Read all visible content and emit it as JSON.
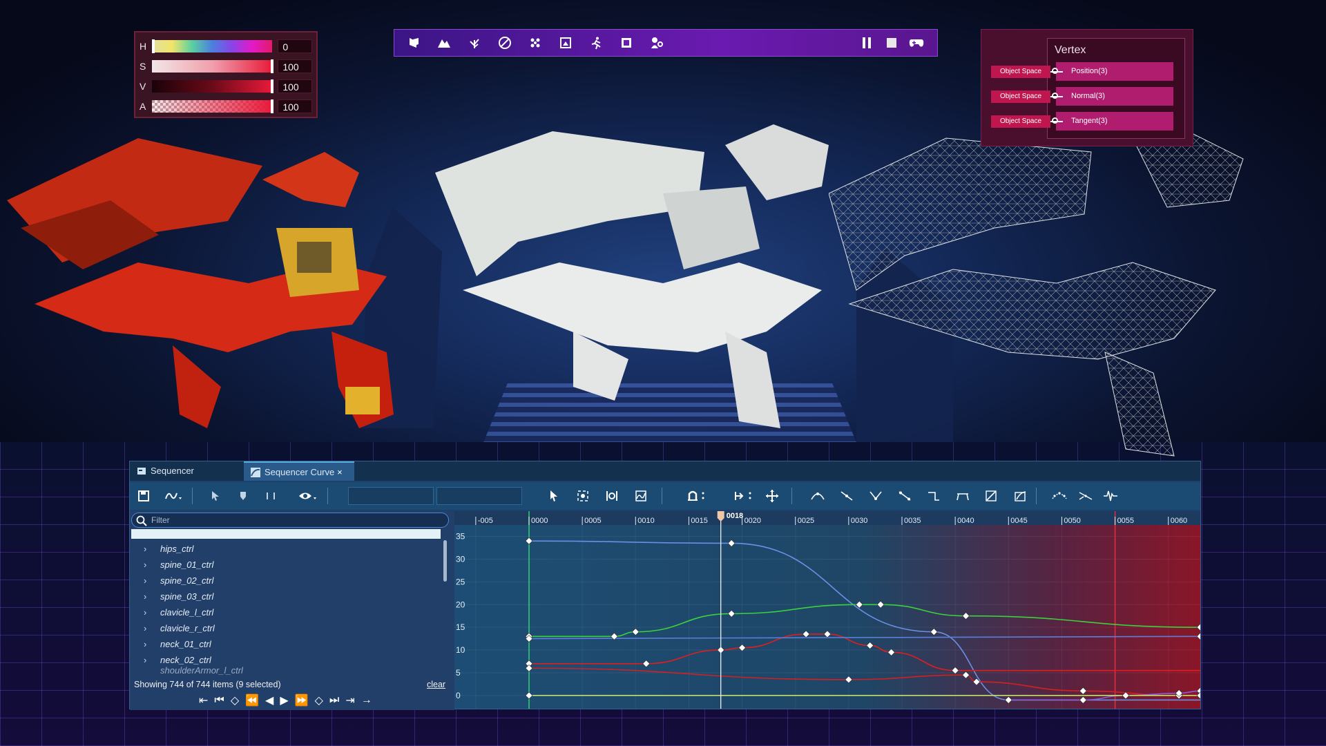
{
  "color_picker": {
    "rows": [
      {
        "label": "H",
        "value": "0"
      },
      {
        "label": "S",
        "value": "100"
      },
      {
        "label": "V",
        "value": "100"
      },
      {
        "label": "A",
        "value": "100"
      }
    ]
  },
  "top_toolbar": {
    "left_icons": [
      "select-object-icon",
      "terrain-icon",
      "foliage-icon",
      "paint-icon",
      "particles-icon",
      "texture-icon",
      "animation-runner-icon",
      "mesh-icon",
      "character-icon"
    ],
    "right_icons": [
      "pause-icon",
      "stop-icon",
      "gamepad-icon"
    ]
  },
  "vertex_node": {
    "title": "Vertex",
    "ports": [
      "Position(3)",
      "Normal(3)",
      "Tangent(3)"
    ],
    "inputs": [
      "Object Space",
      "Object Space",
      "Object Space"
    ]
  },
  "sequencer": {
    "tabs": [
      {
        "label": "Sequencer"
      },
      {
        "label": "Sequencer Curve",
        "close": "×"
      }
    ],
    "filter_placeholder": "Filter",
    "tracks": [
      "hips_ctrl",
      "spine_01_ctrl",
      "spine_02_ctrl",
      "spine_03_ctrl",
      "clavicle_l_ctrl",
      "clavicle_r_ctrl",
      "neck_01_ctrl",
      "neck_02_ctrl",
      "shoulderArmor_l_ctrl"
    ],
    "status": "Showing 744 of 744 items (9 selected)",
    "clear_label": "clear",
    "ruler_labels": [
      "-005",
      "0000",
      "0005",
      "0010",
      "0015",
      "0020",
      "0025",
      "0030",
      "0035",
      "0040",
      "0045",
      "0050",
      "0055",
      "0060",
      "00"
    ],
    "current_frame": "0018",
    "y_labels": [
      "35",
      "30",
      "25",
      "20",
      "15",
      "10",
      "5",
      "0"
    ]
  },
  "chart_data": {
    "type": "line",
    "xlabel": "",
    "ylabel": "",
    "xlim": [
      -7,
      63
    ],
    "ylim": [
      -2,
      36
    ],
    "current_frame": 18,
    "series": [
      {
        "color": "#6a8fe6",
        "x": [
          0,
          19,
          38,
          45
        ],
        "y": [
          34,
          33.5,
          14,
          -1
        ]
      },
      {
        "color": "#3bd23b",
        "x": [
          0,
          8,
          10,
          19,
          31,
          33,
          41,
          63
        ],
        "y": [
          13,
          13,
          14,
          18,
          20,
          20,
          17.5,
          15
        ]
      },
      {
        "color": "#e01e1e",
        "x": [
          0,
          11,
          18,
          20,
          26,
          28,
          32,
          34,
          40
        ],
        "y": [
          7,
          7,
          10,
          10.5,
          13.5,
          13.5,
          11,
          9.5,
          5.5
        ]
      },
      {
        "color": "#d32020",
        "x": [
          0,
          30,
          41,
          42,
          52,
          61
        ],
        "y": [
          6,
          3.5,
          4.5,
          3,
          1,
          0
        ]
      },
      {
        "color": "#8a5cd8",
        "x": [
          45,
          52,
          56,
          61,
          63
        ],
        "y": [
          -1,
          -1,
          0,
          0.5,
          1
        ]
      },
      {
        "color": "#5a7fd8",
        "x": [
          0,
          63
        ],
        "y": [
          12.5,
          13
        ]
      },
      {
        "color": "#c2e06a",
        "x": [
          0,
          63
        ],
        "y": [
          0,
          0
        ]
      }
    ]
  }
}
